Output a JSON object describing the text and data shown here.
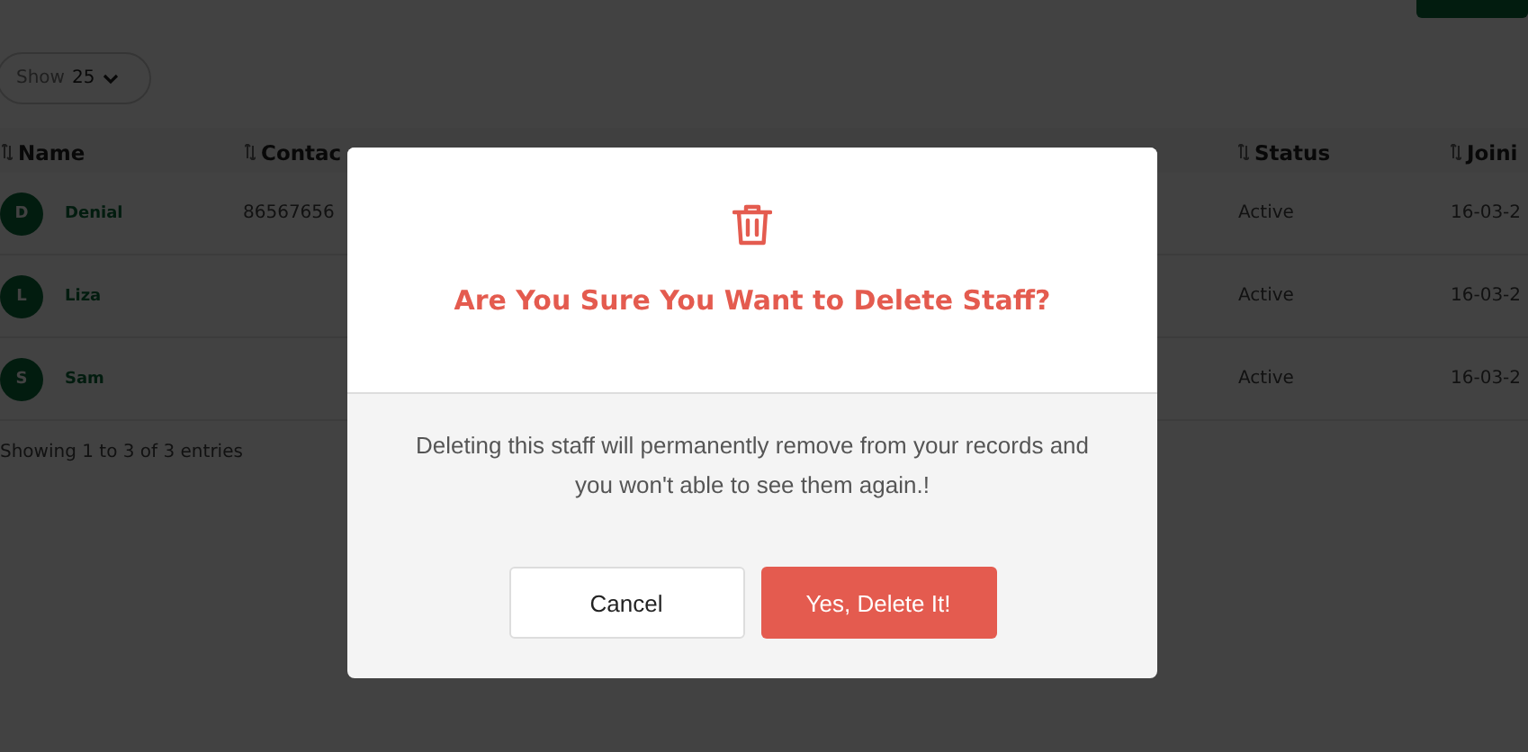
{
  "page_size": {
    "label": "Show",
    "value": "25"
  },
  "table": {
    "columns": [
      "Name",
      "Contac",
      "",
      "",
      "",
      "Status",
      "Joini"
    ],
    "rows": [
      {
        "initial": "D",
        "name": "Denial",
        "contact": "86567656",
        "status": "Active",
        "joining": "16-03-2"
      },
      {
        "initial": "L",
        "name": "Liza",
        "contact": "",
        "status": "Active",
        "joining": "16-03-2"
      },
      {
        "initial": "S",
        "name": "Sam",
        "contact": "",
        "status": "Active",
        "joining": "16-03-2"
      }
    ]
  },
  "entries_info": "Showing 1 to 3 of 3 entries",
  "dialog": {
    "title": "Are You Sure You Want to Delete Staff?",
    "message": "Deleting this staff will permanently remove from your records and you won't able to see them again.!",
    "buttons": [
      {
        "label": "Cancel",
        "kind": "secondary"
      },
      {
        "label": "Yes, Delete It!",
        "kind": "danger"
      }
    ]
  }
}
